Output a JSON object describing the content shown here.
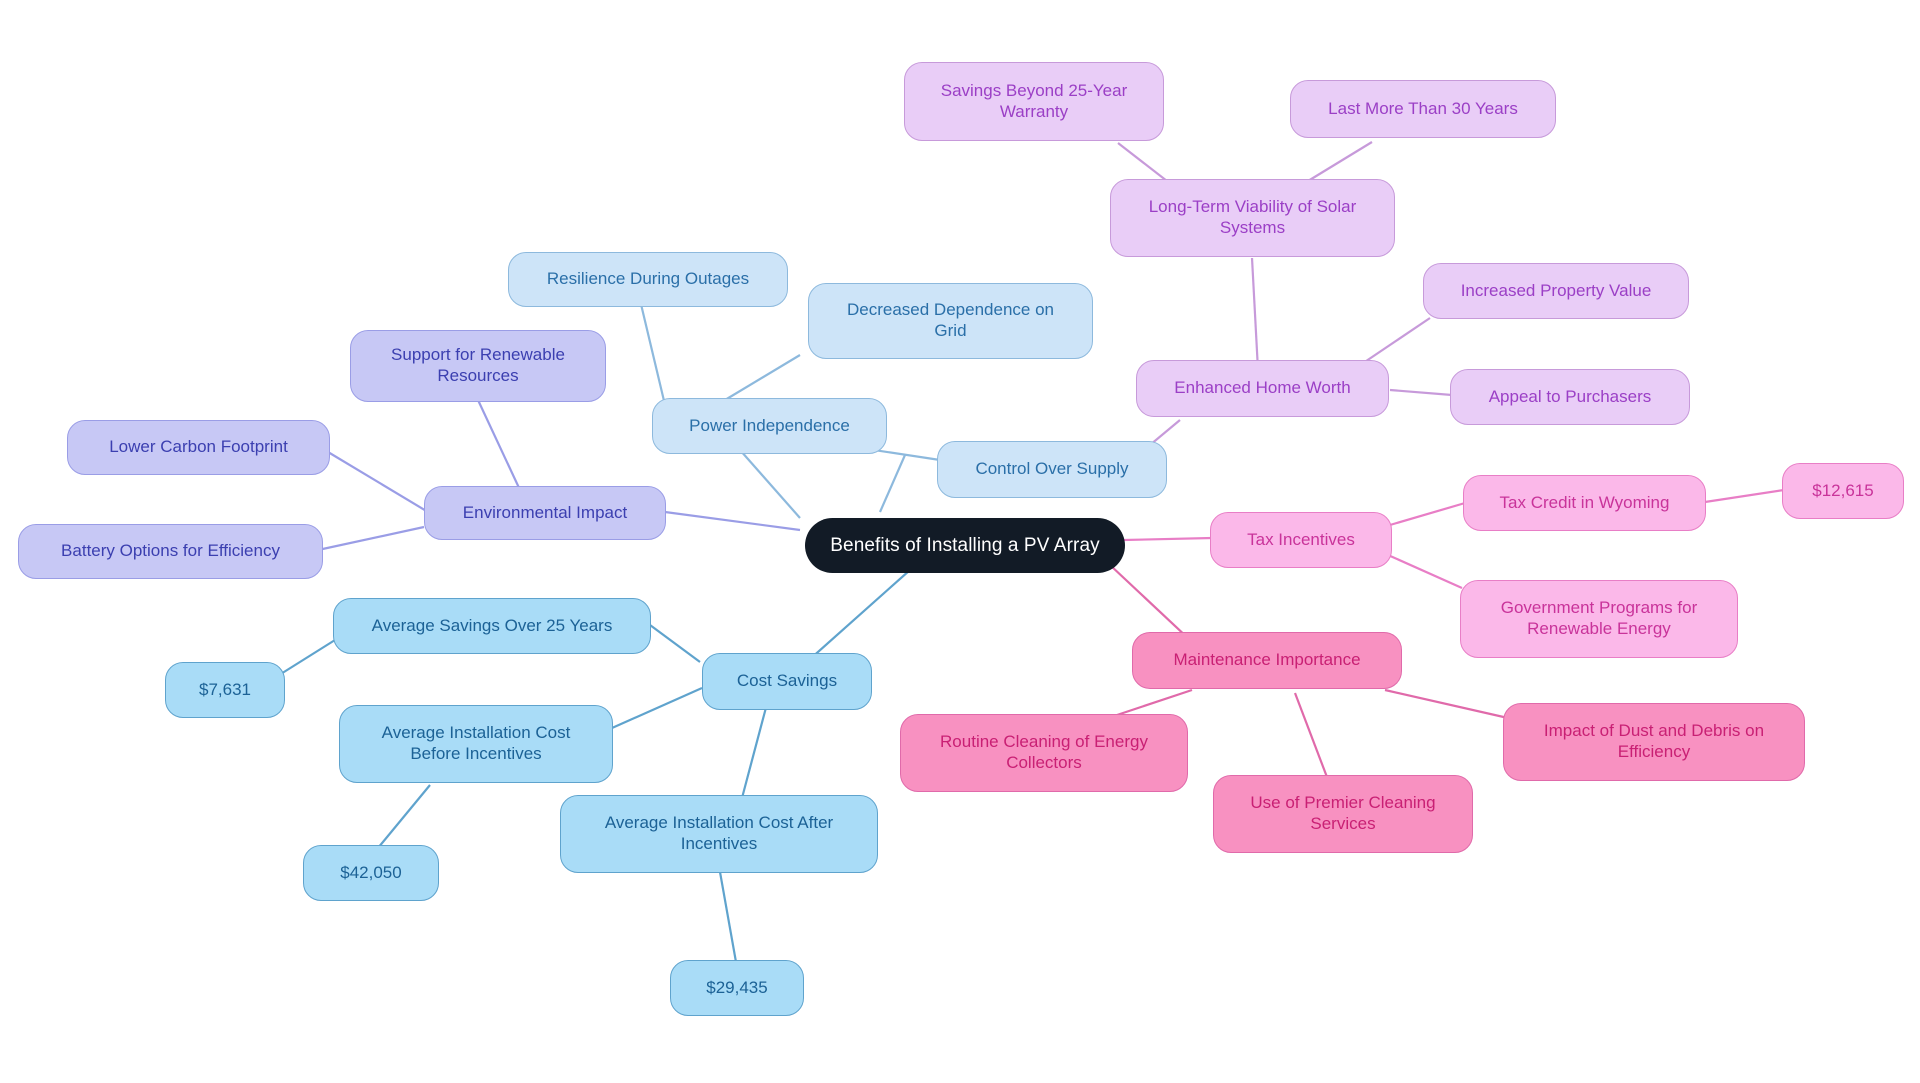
{
  "diagram": {
    "type": "mindmap",
    "title": "Benefits of Installing a PV Array",
    "background": "#ffffff",
    "palette": {
      "root_fill": "#121b26",
      "root_text": "#ffffff",
      "periwinkle_fill": "#c7c8f5",
      "periwinkle_border": "#9a9de6",
      "periwinkle_text": "#3b3fb0",
      "light_blue_fill": "#cde4f8",
      "light_blue_border": "#8db9dd",
      "light_blue_text": "#2a6fa8",
      "blue_fill": "#a9dcf7",
      "blue_border": "#5fa3cd",
      "blue_text": "#1c6296",
      "orchid_fill": "#e9cdf7",
      "orchid_border": "#c79ada",
      "orchid_text": "#9b3fc6",
      "pink_fill": "#fbb8e9",
      "pink_border": "#e87ec6",
      "pink_text": "#c9339a",
      "deep_pink_fill": "#f891c1",
      "deep_pink_border": "#e06aaa",
      "deep_pink_text": "#c92074"
    }
  },
  "nodes": {
    "root": {
      "label": "Benefits of Installing a PV Array"
    },
    "environmental_impact": {
      "label": "Environmental Impact"
    },
    "lower_carbon_footprint": {
      "label": "Lower Carbon Footprint"
    },
    "support_renewable_resources": {
      "label": "Support for Renewable\nResources"
    },
    "battery_options": {
      "label": "Battery Options for Efficiency"
    },
    "power_independence": {
      "label": "Power Independence"
    },
    "resilience_outages": {
      "label": "Resilience During Outages"
    },
    "decreased_dependence_grid": {
      "label": "Decreased Dependence on\nGrid"
    },
    "control_over_supply": {
      "label": "Control Over Supply"
    },
    "long_term_viability": {
      "label": "Long-Term Viability of Solar\nSystems"
    },
    "savings_beyond_warranty": {
      "label": "Savings Beyond 25-Year\nWarranty"
    },
    "last_more_than_30": {
      "label": "Last More Than 30 Years"
    },
    "enhanced_home_worth": {
      "label": "Enhanced Home Worth"
    },
    "increased_property_value": {
      "label": "Increased Property Value"
    },
    "appeal_to_purchasers": {
      "label": "Appeal to Purchasers"
    },
    "tax_incentives": {
      "label": "Tax Incentives"
    },
    "tax_credit_wyoming": {
      "label": "Tax Credit in Wyoming"
    },
    "tax_credit_amount": {
      "label": "$12,615"
    },
    "government_programs": {
      "label": "Government Programs for\nRenewable Energy"
    },
    "maintenance_importance": {
      "label": "Maintenance Importance"
    },
    "routine_cleaning": {
      "label": "Routine Cleaning of Energy\nCollectors"
    },
    "premier_cleaning_services": {
      "label": "Use of Premier Cleaning\nServices"
    },
    "dust_debris_impact": {
      "label": "Impact of Dust and Debris on\nEfficiency"
    },
    "cost_savings": {
      "label": "Cost Savings"
    },
    "avg_savings_25_years": {
      "label": "Average Savings Over 25 Years"
    },
    "avg_savings_amount": {
      "label": "$7,631"
    },
    "avg_install_before": {
      "label": "Average Installation Cost\nBefore Incentives"
    },
    "avg_install_before_amount": {
      "label": "$42,050"
    },
    "avg_install_after": {
      "label": "Average Installation Cost After\nIncentives"
    },
    "avg_install_after_amount": {
      "label": "$29,435"
    }
  },
  "branches": [
    {
      "name": "Environmental Impact",
      "color": "#9a9de6",
      "children": [
        "Lower Carbon Footprint",
        "Support for Renewable Resources",
        "Battery Options for Efficiency"
      ]
    },
    {
      "name": "Power Independence",
      "color": "#8db9dd",
      "children": [
        "Resilience During Outages",
        "Decreased Dependence on Grid",
        "Control Over Supply"
      ]
    },
    {
      "name": "Long-Term Viability of Solar Systems",
      "color": "#c79ada",
      "children": [
        "Savings Beyond 25-Year Warranty",
        "Last More Than 30 Years",
        "Enhanced Home Worth",
        "Increased Property Value",
        "Appeal to Purchasers"
      ]
    },
    {
      "name": "Tax Incentives",
      "color": "#e87ec6",
      "children": [
        "Tax Credit in Wyoming",
        "$12,615",
        "Government Programs for Renewable Energy"
      ]
    },
    {
      "name": "Maintenance Importance",
      "color": "#e06aaa",
      "children": [
        "Routine Cleaning of Energy Collectors",
        "Use of Premier Cleaning Services",
        "Impact of Dust and Debris on Efficiency"
      ]
    },
    {
      "name": "Cost Savings",
      "color": "#5fa3cd",
      "children": [
        "Average Savings Over 25 Years",
        "$7,631",
        "Average Installation Cost Before Incentives",
        "$42,050",
        "Average Installation Cost After Incentives",
        "$29,435"
      ]
    }
  ]
}
